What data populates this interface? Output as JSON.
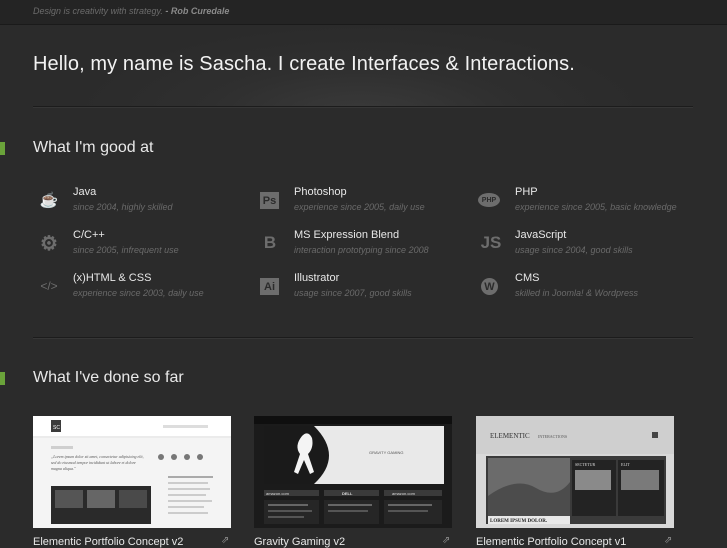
{
  "topbar": {
    "quote": "Design is creativity with strategy.",
    "author": "- Rob Curedale"
  },
  "hero": {
    "title": "Hello, my name is Sascha. I create Interfaces & Interactions."
  },
  "skills_section": {
    "title": "What I'm good at",
    "items": [
      {
        "icon": "java-icon",
        "glyph": "☕",
        "name": "Java",
        "desc": "since 2004, highly skilled"
      },
      {
        "icon": "photoshop-icon",
        "glyph": "Ps",
        "name": "Photoshop",
        "desc": "experience since 2005, daily use"
      },
      {
        "icon": "php-icon",
        "glyph": "PHP",
        "name": "PHP",
        "desc": "experience since 2005, basic knowledge"
      },
      {
        "icon": "gear-icon",
        "glyph": "⚙",
        "name": "C/C++",
        "desc": "since 2005, infrequent use"
      },
      {
        "icon": "blend-icon",
        "glyph": "B",
        "name": "MS Expression Blend",
        "desc": "interaction prototyping since 2008"
      },
      {
        "icon": "javascript-icon",
        "glyph": "JS",
        "name": "JavaScript",
        "desc": "usage since 2004, good skills"
      },
      {
        "icon": "code-icon",
        "glyph": "</>",
        "name": "(x)HTML & CSS",
        "desc": "experience since 2003, daily use"
      },
      {
        "icon": "illustrator-icon",
        "glyph": "Ai",
        "name": "Illustrator",
        "desc": "usage since 2007, good skills"
      },
      {
        "icon": "wordpress-icon",
        "glyph": "W",
        "name": "CMS",
        "desc": "skilled in Joomla! & Wordpress"
      }
    ]
  },
  "work_section": {
    "title": "What I've done so far",
    "items": [
      {
        "caption": "Elementic Portfolio Concept v2"
      },
      {
        "caption": "Gravity Gaming v2"
      },
      {
        "caption": "Elementic Portfolio Concept v1"
      }
    ]
  },
  "thumbs": {
    "t1_logo": "SC",
    "t1_quote": "„Lorem ipsum dolor sit amet, consectetur adipisicing elit, sed do eiusmod tempor incididunt ut labore et dolore magna aliqua.\"",
    "t2_banner": "GRAVITY GAMING",
    "t2_tag1": "amazon.com",
    "t2_tag2": "DELL",
    "t3_brand": "ELEMENTIC",
    "t3_brand2": "INTERACTIONS",
    "t3_card1": "SECTETUR",
    "t3_card2": "ELIT",
    "t3_footer": "LOREM IPSUM DOLOR."
  }
}
